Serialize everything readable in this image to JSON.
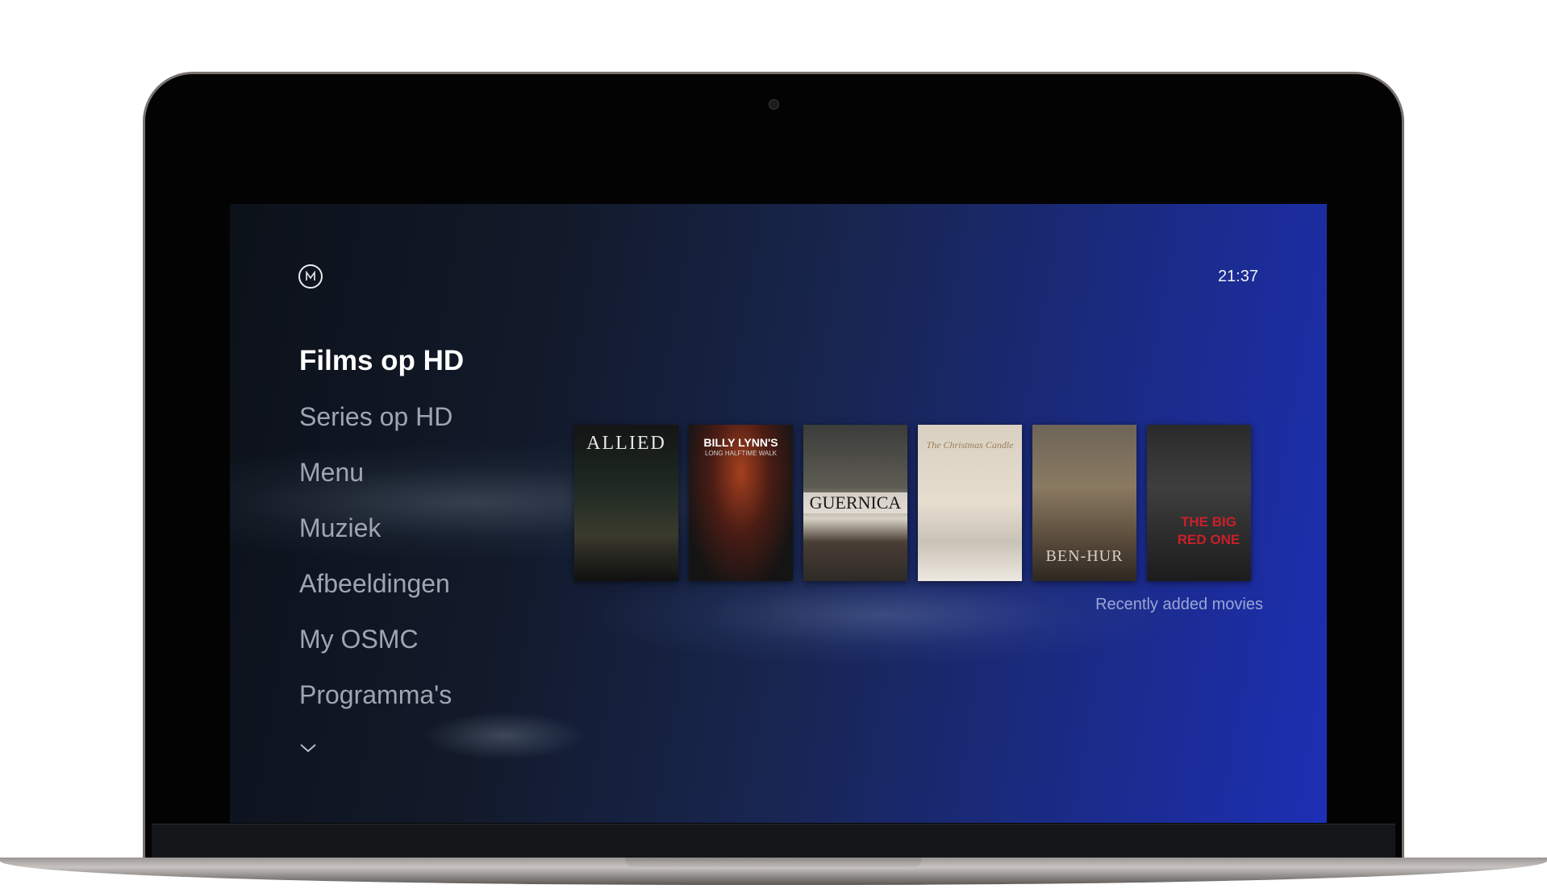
{
  "clock": "21:37",
  "menu": {
    "items": [
      {
        "label": "Films op HD",
        "active": true
      },
      {
        "label": "Series op  HD",
        "active": false
      },
      {
        "label": "Menu",
        "active": false
      },
      {
        "label": "Muziek",
        "active": false
      },
      {
        "label": "Afbeeldingen",
        "active": false
      },
      {
        "label": "My OSMC",
        "active": false
      },
      {
        "label": "Programma's",
        "active": false
      }
    ]
  },
  "widget": {
    "caption": "Recently added movies",
    "posters": [
      {
        "title": "ALLIED",
        "subtitle": ""
      },
      {
        "title": "BILLY LYNN'S",
        "subtitle": "LONG HALFTIME WALK"
      },
      {
        "title": "GUERNICA",
        "subtitle": ""
      },
      {
        "title": "The Christmas Candle",
        "subtitle": ""
      },
      {
        "title": "BEN-HUR",
        "subtitle": ""
      },
      {
        "title": "THE BIG RED ONE",
        "subtitle": ""
      }
    ]
  },
  "colors": {
    "accent": "#1d2fb4",
    "text_active": "#ffffff",
    "text_inactive": "#9fa6b2",
    "caption": "#9aa6d6"
  },
  "icons": {
    "logo": "osmc-logo-icon",
    "more": "chevron-down-icon"
  }
}
